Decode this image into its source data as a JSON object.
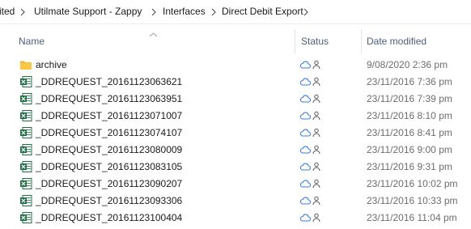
{
  "breadcrumb": {
    "items": [
      {
        "label": "ited"
      },
      {
        "label": "Utilmate Support - Zappy"
      },
      {
        "label": "Interfaces"
      },
      {
        "label": "Direct Debit Export"
      }
    ]
  },
  "columns": {
    "name": "Name",
    "status": "Status",
    "date_modified": "Date modified",
    "sort_column": "Name",
    "sort_direction": "ascending"
  },
  "colors": {
    "folder": "#f8c842",
    "excel": "#1d7044",
    "cloud_status": "#3b7dd8",
    "header_text": "#4c607a",
    "date_text": "#6d6d6d"
  },
  "files": [
    {
      "name": "archive",
      "type": "folder",
      "icon": "folder-icon",
      "status": "online-only",
      "date": "9/08/2020 2:36 pm"
    },
    {
      "name": "_DDREQUEST_20161123063621",
      "type": "excel",
      "icon": "excel-file-icon",
      "status": "online-only",
      "date": "23/11/2016 7:36 pm"
    },
    {
      "name": "_DDREQUEST_20161123063951",
      "type": "excel",
      "icon": "excel-file-icon",
      "status": "online-only",
      "date": "23/11/2016 7:39 pm"
    },
    {
      "name": "_DDREQUEST_20161123071007",
      "type": "excel",
      "icon": "excel-file-icon",
      "status": "online-only",
      "date": "23/11/2016 8:10 pm"
    },
    {
      "name": "_DDREQUEST_20161123074107",
      "type": "excel",
      "icon": "excel-file-icon",
      "status": "online-only",
      "date": "23/11/2016 8:41 pm"
    },
    {
      "name": "_DDREQUEST_20161123080009",
      "type": "excel",
      "icon": "excel-file-icon",
      "status": "online-only",
      "date": "23/11/2016 9:00 pm"
    },
    {
      "name": "_DDREQUEST_20161123083105",
      "type": "excel",
      "icon": "excel-file-icon",
      "status": "online-only",
      "date": "23/11/2016 9:31 pm"
    },
    {
      "name": "_DDREQUEST_20161123090207",
      "type": "excel",
      "icon": "excel-file-icon",
      "status": "online-only",
      "date": "23/11/2016 10:02 pm"
    },
    {
      "name": "_DDREQUEST_20161123093306",
      "type": "excel",
      "icon": "excel-file-icon",
      "status": "online-only",
      "date": "23/11/2016 10:33 pm"
    },
    {
      "name": "_DDREQUEST_20161123100404",
      "type": "excel",
      "icon": "excel-file-icon",
      "status": "online-only",
      "date": "23/11/2016 11:04 pm"
    }
  ]
}
